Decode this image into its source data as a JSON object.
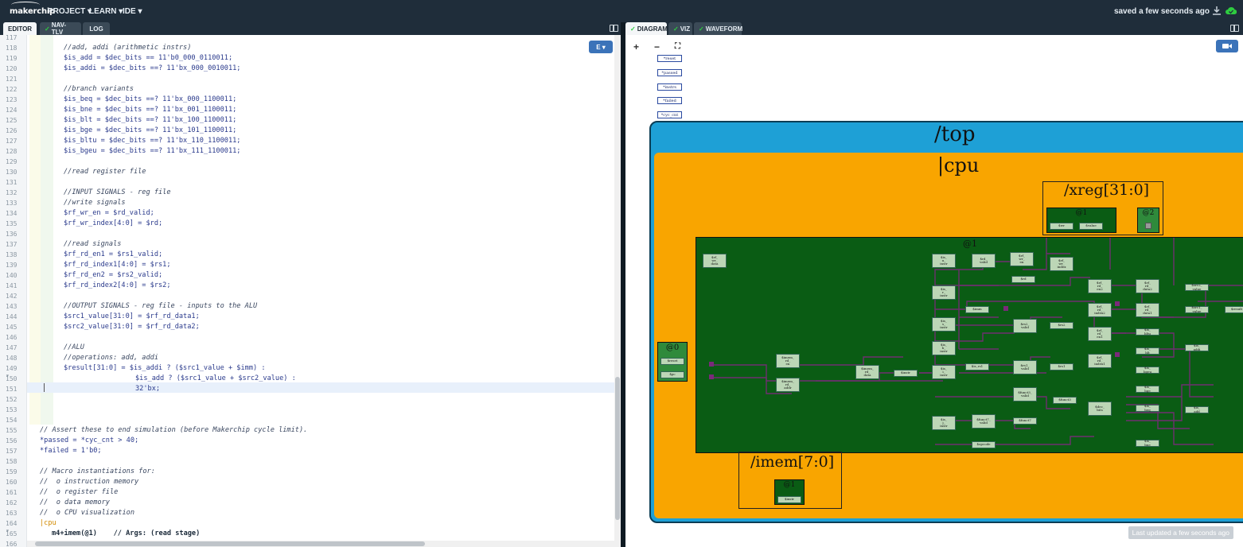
{
  "topbar": {
    "logo_text": "makerchip",
    "menus": [
      "PROJECT ▾",
      "LEARN ▾",
      "IDE ▾"
    ],
    "saved_status": "saved a few seconds ago"
  },
  "left_tabs": [
    {
      "label": "EDITOR",
      "active": true,
      "check": false
    },
    {
      "label": "NAV-TLV",
      "active": false,
      "check": true
    },
    {
      "label": "LOG",
      "active": false,
      "check": false
    }
  ],
  "right_tabs": [
    {
      "label": "DIAGRAM",
      "active": true,
      "check": true
    },
    {
      "label": "VIZ",
      "active": false,
      "check": true
    },
    {
      "label": "WAVEFORM",
      "active": false,
      "check": true
    }
  ],
  "editor": {
    "e_button": "E ▾",
    "lines": [
      {
        "n": "117",
        "t": "",
        "c": "cmt",
        "ind": 0
      },
      {
        "n": "118",
        "t": "//add, addi (arithmetic instrs)",
        "c": "cmt",
        "ind": 2
      },
      {
        "n": "119",
        "t": "$is_add = $dec_bits == 11'b0_000_0110011;",
        "c": "",
        "ind": 2
      },
      {
        "n": "120",
        "t": "$is_addi = $dec_bits ==? 11'bx_000_0010011;",
        "c": "",
        "ind": 2
      },
      {
        "n": "121",
        "t": "",
        "c": "",
        "ind": 0
      },
      {
        "n": "122",
        "t": "//branch variants",
        "c": "cmt",
        "ind": 2
      },
      {
        "n": "123",
        "t": "$is_beq = $dec_bits ==? 11'bx_000_1100011;",
        "c": "",
        "ind": 2
      },
      {
        "n": "124",
        "t": "$is_bne = $dec_bits ==? 11'bx_001_1100011;",
        "c": "",
        "ind": 2
      },
      {
        "n": "125",
        "t": "$is_blt = $dec_bits ==? 11'bx_100_1100011;",
        "c": "",
        "ind": 2
      },
      {
        "n": "126",
        "t": "$is_bge = $dec_bits ==? 11'bx_101_1100011;",
        "c": "",
        "ind": 2
      },
      {
        "n": "127",
        "t": "$is_bltu = $dec_bits ==? 11'bx_110_1100011;",
        "c": "",
        "ind": 2
      },
      {
        "n": "128",
        "t": "$is_bgeu = $dec_bits ==? 11'bx_111_1100011;",
        "c": "",
        "ind": 2
      },
      {
        "n": "129",
        "t": "",
        "c": "",
        "ind": 0
      },
      {
        "n": "130",
        "t": "//read register file",
        "c": "cmt",
        "ind": 2
      },
      {
        "n": "131",
        "t": "",
        "c": "",
        "ind": 0
      },
      {
        "n": "132",
        "t": "//INPUT SIGNALS - reg file",
        "c": "cmt",
        "ind": 2
      },
      {
        "n": "133",
        "t": "//write signals",
        "c": "cmt",
        "ind": 2
      },
      {
        "n": "134",
        "t": "$rf_wr_en = $rd_valid;",
        "c": "",
        "ind": 2
      },
      {
        "n": "135",
        "t": "$rf_wr_index[4:0] = $rd;",
        "c": "",
        "ind": 2
      },
      {
        "n": "136",
        "t": "",
        "c": "",
        "ind": 0
      },
      {
        "n": "137",
        "t": "//read signals",
        "c": "cmt",
        "ind": 2
      },
      {
        "n": "138",
        "t": "$rf_rd_en1 = $rs1_valid;",
        "c": "",
        "ind": 2
      },
      {
        "n": "139",
        "t": "$rf_rd_index1[4:0] = $rs1;",
        "c": "",
        "ind": 2
      },
      {
        "n": "140",
        "t": "$rf_rd_en2 = $rs2_valid;",
        "c": "",
        "ind": 2
      },
      {
        "n": "141",
        "t": "$rf_rd_index2[4:0] = $rs2;",
        "c": "",
        "ind": 2
      },
      {
        "n": "142",
        "t": "",
        "c": "",
        "ind": 0
      },
      {
        "n": "143",
        "t": "//OUTPUT SIGNALS - reg file - inputs to the ALU",
        "c": "cmt",
        "ind": 2
      },
      {
        "n": "144",
        "t": "$src1_value[31:0] = $rf_rd_data1;",
        "c": "",
        "ind": 2
      },
      {
        "n": "145",
        "t": "$src2_value[31:0] = $rf_rd_data2;",
        "c": "",
        "ind": 2
      },
      {
        "n": "146",
        "t": "",
        "c": "",
        "ind": 0
      },
      {
        "n": "147",
        "t": "//ALU",
        "c": "cmt",
        "ind": 2
      },
      {
        "n": "148",
        "t": "//operations: add, addi",
        "c": "cmt",
        "ind": 2
      },
      {
        "n": "149 ▾",
        "t": "$result[31:0] = $is_addi ? ($src1_value + $imm) :",
        "c": "",
        "ind": 2
      },
      {
        "n": "150",
        "t": "$is_add ? ($src1_value + $src2_value) :",
        "c": "",
        "ind": 8
      },
      {
        "n": "151",
        "t": "32'bx;",
        "c": "",
        "ind": 8
      },
      {
        "n": "152",
        "t": "",
        "c": "",
        "ind": 0
      },
      {
        "n": "153",
        "t": "",
        "c": "",
        "ind": 0
      },
      {
        "n": "154",
        "t": "",
        "c": "",
        "ind": 0
      },
      {
        "n": "155",
        "t": "// Assert these to end simulation (before Makerchip cycle limit).",
        "c": "cmt",
        "ind": 0
      },
      {
        "n": "156",
        "t": "*passed = *cyc_cnt > 40;",
        "c": "",
        "ind": 0
      },
      {
        "n": "157",
        "t": "*failed = 1'b0;",
        "c": "",
        "ind": 0
      },
      {
        "n": "158",
        "t": "",
        "c": "",
        "ind": 0
      },
      {
        "n": "159",
        "t": "// Macro instantiations for:",
        "c": "cmt",
        "ind": 0
      },
      {
        "n": "160",
        "t": "//  o instruction memory",
        "c": "cmt",
        "ind": 0
      },
      {
        "n": "161",
        "t": "//  o register file",
        "c": "cmt",
        "ind": 0
      },
      {
        "n": "162",
        "t": "//  o data memory",
        "c": "cmt",
        "ind": 0
      },
      {
        "n": "163",
        "t": "//  o CPU visualization",
        "c": "cmt",
        "ind": 0
      },
      {
        "n": "164 ▾",
        "t": "|cpu",
        "c": "kw",
        "ind": 0
      },
      {
        "n": "165",
        "t": "m4+imem(@1)    // Args: (read stage)",
        "c": "macro",
        "ind": 1
      },
      {
        "n": "166",
        "t": "",
        "c": "",
        "ind": 0
      }
    ]
  },
  "diagram": {
    "zoom_in": "+",
    "zoom_out": "−",
    "fit": "⛶",
    "signals": [
      "*reset",
      "*passed",
      "*instrs",
      "*failed",
      "*cyc_cnt"
    ],
    "top_label": "/top",
    "cpu_label": "|cpu",
    "xreg_label": "/xreg[31:0]",
    "imem_label": "/imem[7:0]",
    "stage_main": "@1",
    "stage_xreg1": "@1",
    "stage_xreg2": "@2",
    "stage0": "@0",
    "stage_imem": "@1",
    "last_updated": "Last updated a few seconds ago",
    "nodes": {
      "rf_wr_data": "$rf_\nwr_\ndata",
      "reset": "$reset",
      "pc": "$pc",
      "imem_rd_en": "$imem_\nrd_\nen",
      "imem_rd_addr": "$imem_\nrd_\naddr",
      "imem_rd_data": "$imem_\nrd_\ndata",
      "instr": "$instr",
      "is_u_instr": "$is_\nu_\ninstr",
      "is_r_instr": "$is_\nr_\ninstr",
      "is_s_instr": "$is_\ns_\ninstr",
      "is_b_instr": "$is_\nb_\ninstr",
      "is_i_instr": "$is_\ni_\ninstr",
      "is_j_instr": "$is_\nj_\ninstr",
      "rd_valid": "$rd_\nvalid",
      "rd": "$rd",
      "rf_wr_en": "$rf_\nwr_\nen",
      "rf_wr_index": "$rf_\nwr_\nindex",
      "imm": "$imm",
      "rs2_valid": "$rs2_\nvalid",
      "rs2": "$rs2",
      "rs1_valid": "$rs1_\nvalid",
      "rs1": "$rs1",
      "funct3_valid": "$funct3_\nvalid",
      "funct3": "$funct3",
      "funct7_valid": "$funct7_\nvalid",
      "funct7": "$funct7",
      "opcode": "$opcode",
      "is_rs1": "$is_rs1",
      "rf_rd_en2": "$rf_\nrd_\nen2",
      "rf_rd_index2": "$rf_\nrd_\nindex2",
      "rf_rd_en1": "$rf_\nrd_\nen1",
      "rf_rd_index1": "$rf_\nrd_\nindex1",
      "rf_rd_data2": "$rf_\nrd_\ndata2",
      "rf_rd_data1": "$rf_\nrd_\ndata1",
      "src2_value": "$src2_\nvalue",
      "src1_value": "$src1_\nvalue",
      "result": "$result",
      "dec_bits": "$dec_\nbits",
      "is_bltu": "$is_\nbltu",
      "is_blt": "$is_\nblt",
      "is_bgeu": "$is_\nbgeu",
      "is_bge": "$is_\nbge",
      "is_beq": "$is_\nbeq",
      "is_bne": "$is_\nbne",
      "is_addi": "$is_\naddi",
      "is_add": "$is_\nadd",
      "wr": "$wr",
      "value": "$value",
      "imem_instr": "$instr"
    }
  }
}
